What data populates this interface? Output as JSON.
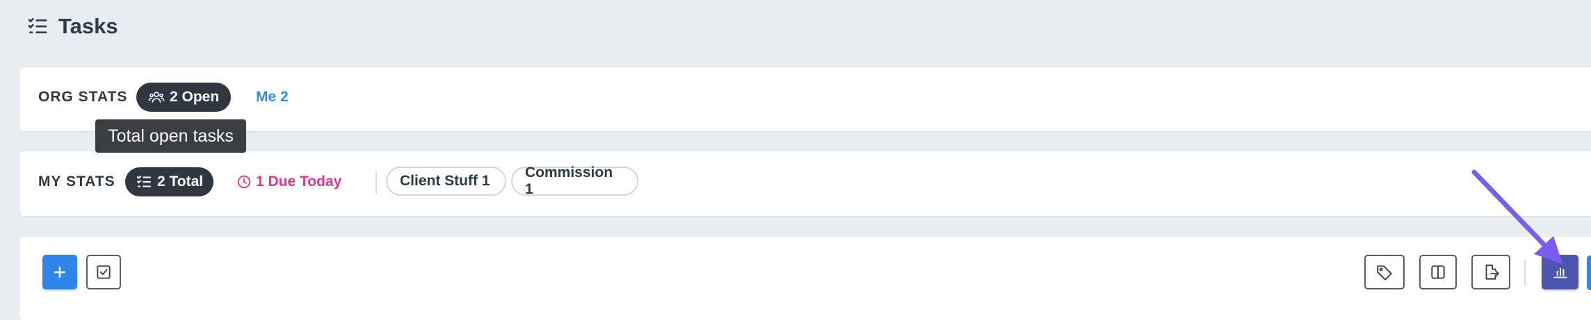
{
  "header": {
    "title": "Tasks",
    "icon": "task-list-icon"
  },
  "org_stats": {
    "label": "ORG STATS",
    "open_pill": {
      "icon": "users-icon",
      "text": "2 Open"
    },
    "me_link": "Me 2",
    "tooltip": "Total open tasks"
  },
  "my_stats": {
    "label": "MY STATS",
    "total_pill": {
      "icon": "task-list-icon",
      "text": "2 Total"
    },
    "due_today": {
      "icon": "clock-icon",
      "text": "1 Due Today"
    },
    "tags": [
      {
        "text": "Client Stuff 1"
      },
      {
        "text": "Commission 1"
      }
    ]
  },
  "toolbar": {
    "add_button": "+",
    "left_icons": [
      "checkbox-icon"
    ],
    "right_icons": [
      "tag-icon",
      "columns-icon",
      "export-icon",
      "bar-chart-icon"
    ]
  },
  "colors": {
    "accent_blue": "#2f86e8",
    "pink": "#e8318a",
    "dark_pill": "#2f3741",
    "chart_button": "#4c56b1",
    "arrow": "#7b5cf0"
  }
}
